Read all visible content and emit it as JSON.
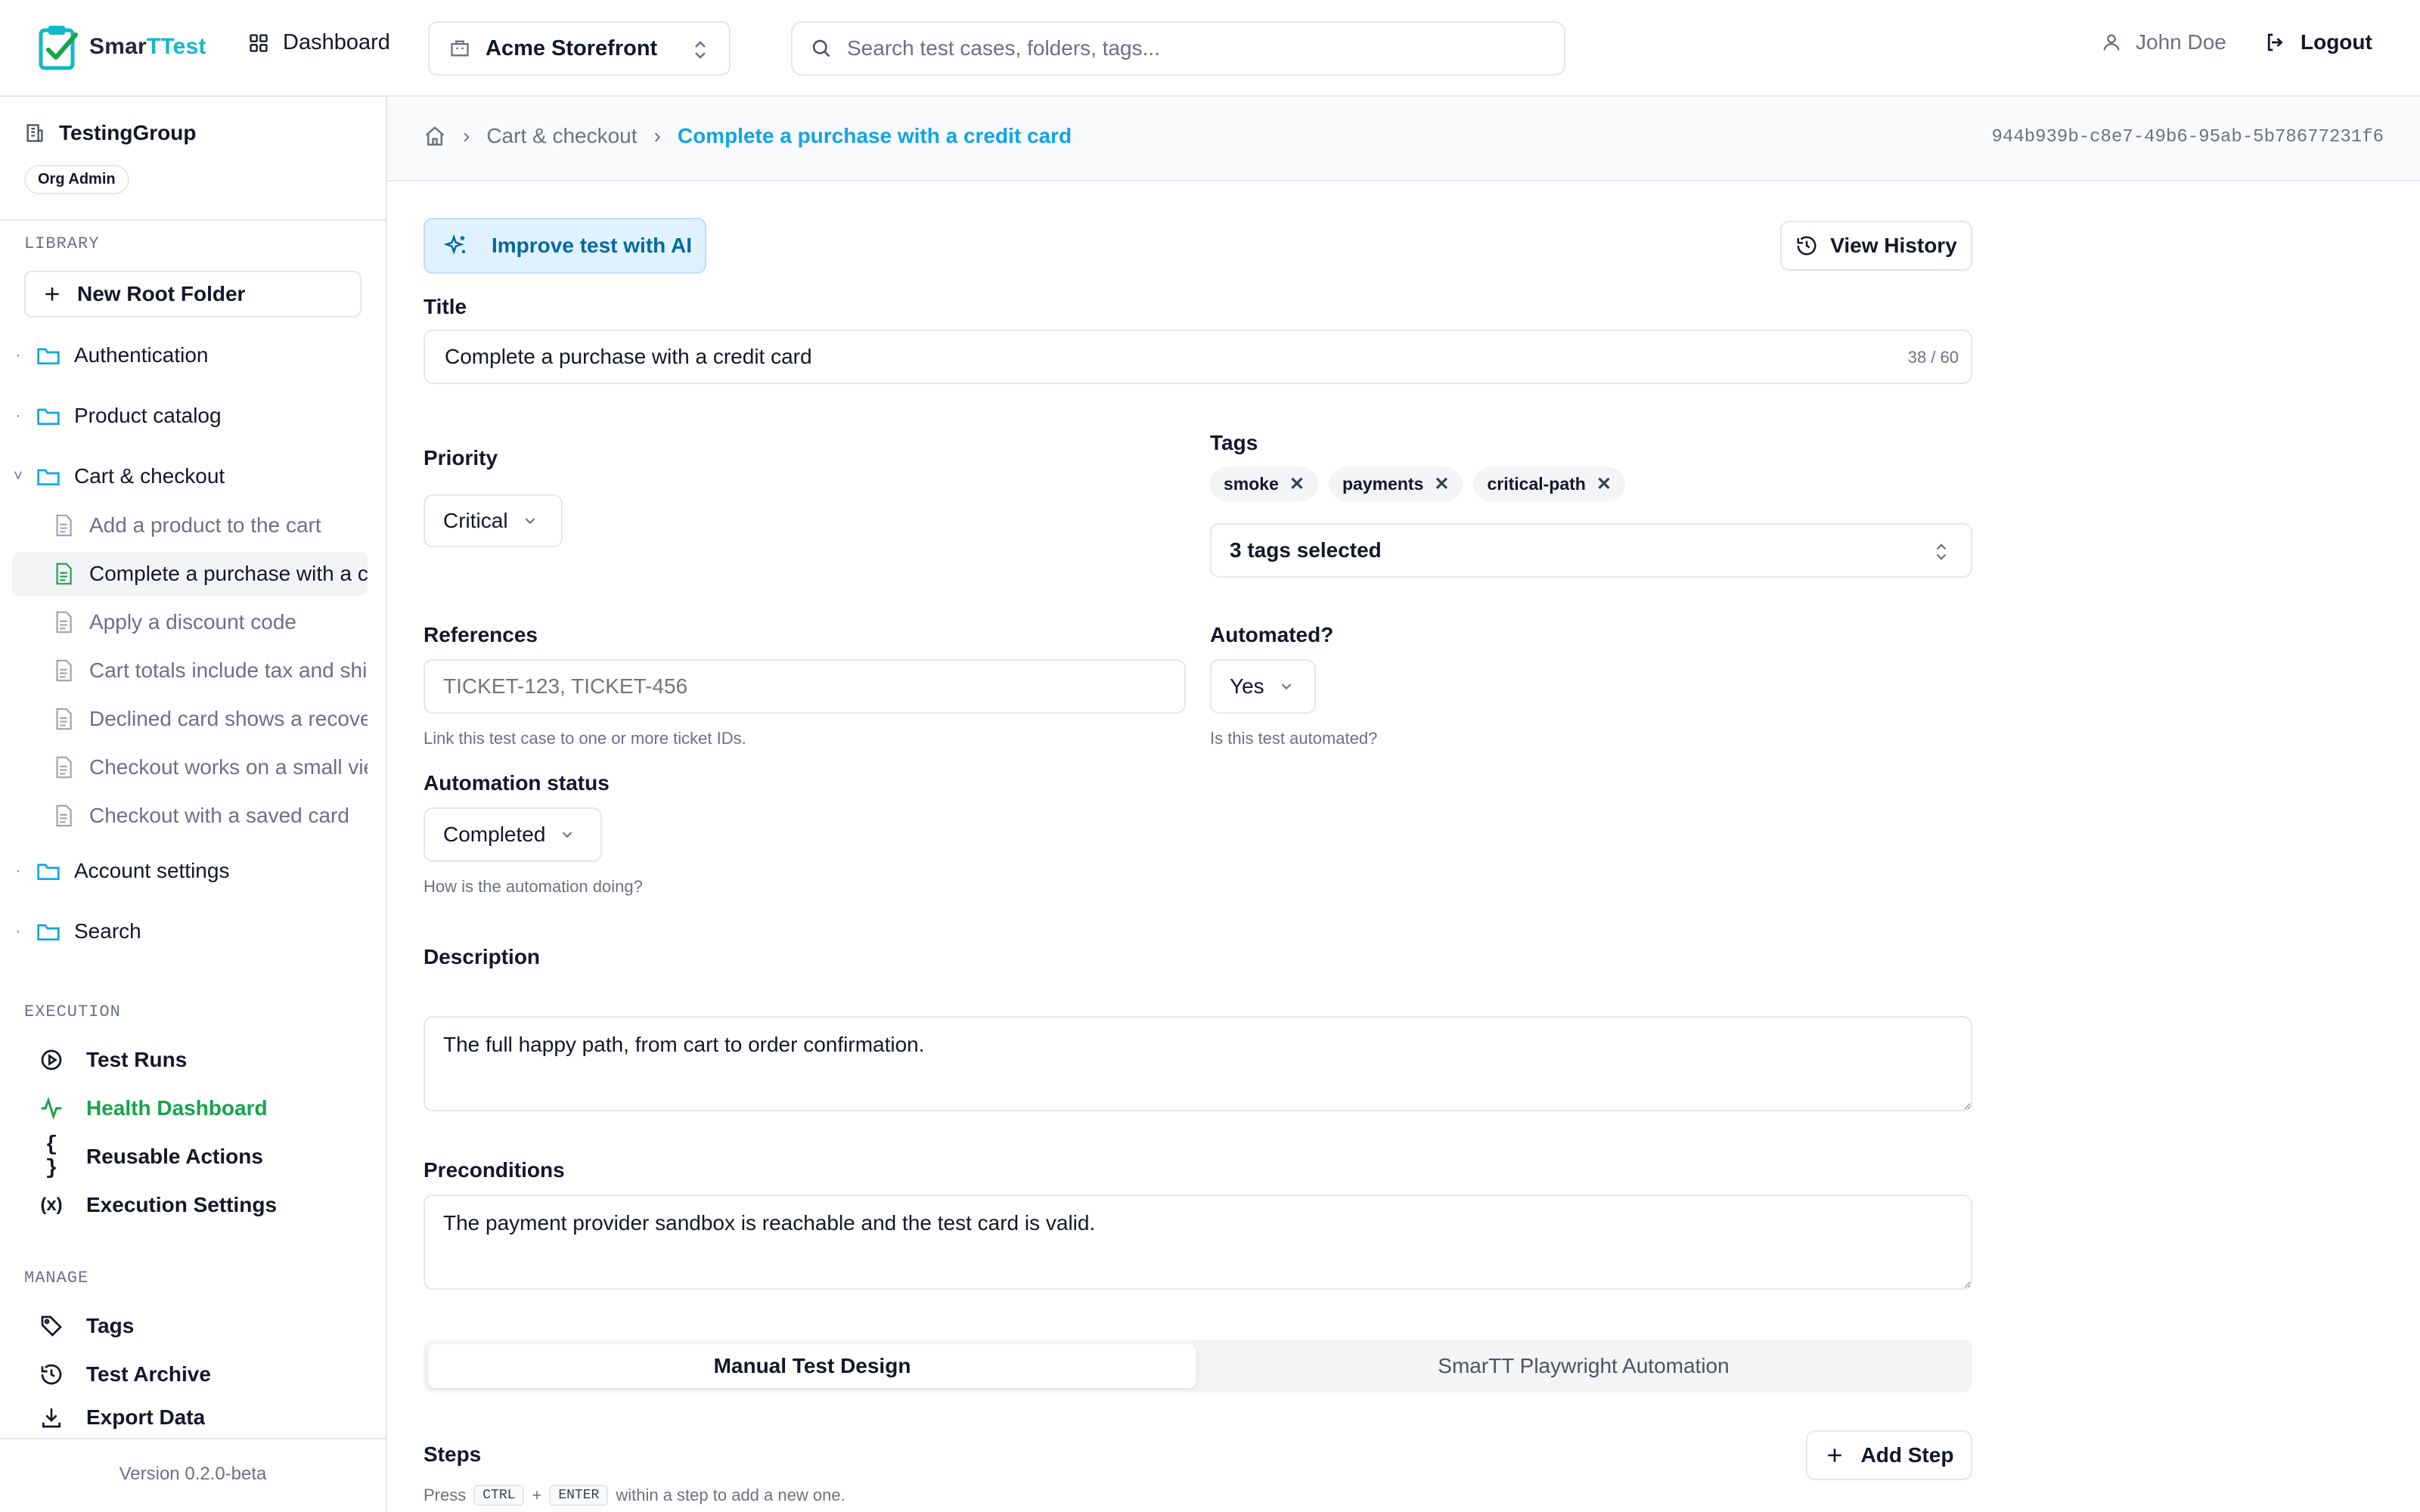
{
  "app": {
    "logo_prefix": "Smar",
    "logo_accent": "TTest",
    "brand_color": "#14b8c9"
  },
  "topbar": {
    "dashboard_label": "Dashboard",
    "project": "Acme Storefront",
    "search_placeholder": "Search test cases, folders, tags...",
    "user_name": "John Doe",
    "logout_label": "Logout"
  },
  "sidebar": {
    "org_name": "TestingGroup",
    "org_role": "Org Admin",
    "library_heading": "LIBRARY",
    "new_root_folder": "New Root Folder",
    "folders": [
      {
        "label": "Authentication"
      },
      {
        "label": "Product catalog"
      },
      {
        "label": "Cart & checkout"
      },
      {
        "label": "Account settings"
      },
      {
        "label": "Search"
      }
    ],
    "files": [
      {
        "label": "Add a product to the cart"
      },
      {
        "label": "Complete a purchase with a credit card"
      },
      {
        "label": "Apply a discount code"
      },
      {
        "label": "Cart totals include tax and shipping"
      },
      {
        "label": "Declined card shows a recoverable error"
      },
      {
        "label": "Checkout works on a small viewport"
      },
      {
        "label": "Checkout with a saved card"
      }
    ],
    "execution_heading": "EXECUTION",
    "execution": [
      {
        "label": "Test Runs"
      },
      {
        "label": "Health Dashboard"
      },
      {
        "label": "Reusable Actions"
      },
      {
        "label": "Execution Settings"
      }
    ],
    "manage_heading": "MANAGE",
    "manage": [
      {
        "label": "Tags"
      },
      {
        "label": "Test Archive"
      },
      {
        "label": "Export Data"
      }
    ],
    "version": "Version 0.2.0-beta"
  },
  "breadcrumb": {
    "parent": "Cart & checkout",
    "current": "Complete a purchase with a credit card",
    "id": "944b939b-c8e7-49b6-95ab-5b78677231f6"
  },
  "form": {
    "ai_button": "Improve test with AI",
    "history_button": "View History",
    "title_label": "Title",
    "title_value": "Complete a purchase with a credit card",
    "title_count": "38 / 60",
    "priority_label": "Priority",
    "priority_value": "Critical",
    "tags_label": "Tags",
    "tags": [
      {
        "label": "smoke"
      },
      {
        "label": "payments"
      },
      {
        "label": "critical-path"
      }
    ],
    "tags_summary": "3 tags selected",
    "references_label": "References",
    "references_placeholder": "TICKET-123, TICKET-456",
    "references_hint": "Link this test case to one or more ticket IDs.",
    "automated_label": "Automated?",
    "automated_value": "Yes",
    "automated_hint": "Is this test automated?",
    "automation_status_label": "Automation status",
    "automation_status_value": "Completed",
    "automation_status_hint": "How is the automation doing?",
    "description_label": "Description",
    "description_value": "The full happy path, from cart to order confirmation.",
    "preconditions_label": "Preconditions",
    "preconditions_value": "The payment provider sandbox is reachable and the test card is valid.",
    "tabs": [
      {
        "label": "Manual Test Design"
      },
      {
        "label": "SmarTT Playwright Automation"
      }
    ],
    "steps_label": "Steps",
    "add_step": "Add Step",
    "steps_hint_press": "Press",
    "steps_hint_ctrl": "CTRL",
    "steps_hint_plus": "+",
    "steps_hint_enter": "ENTER",
    "steps_hint_rest": "within a step to add a new one."
  }
}
